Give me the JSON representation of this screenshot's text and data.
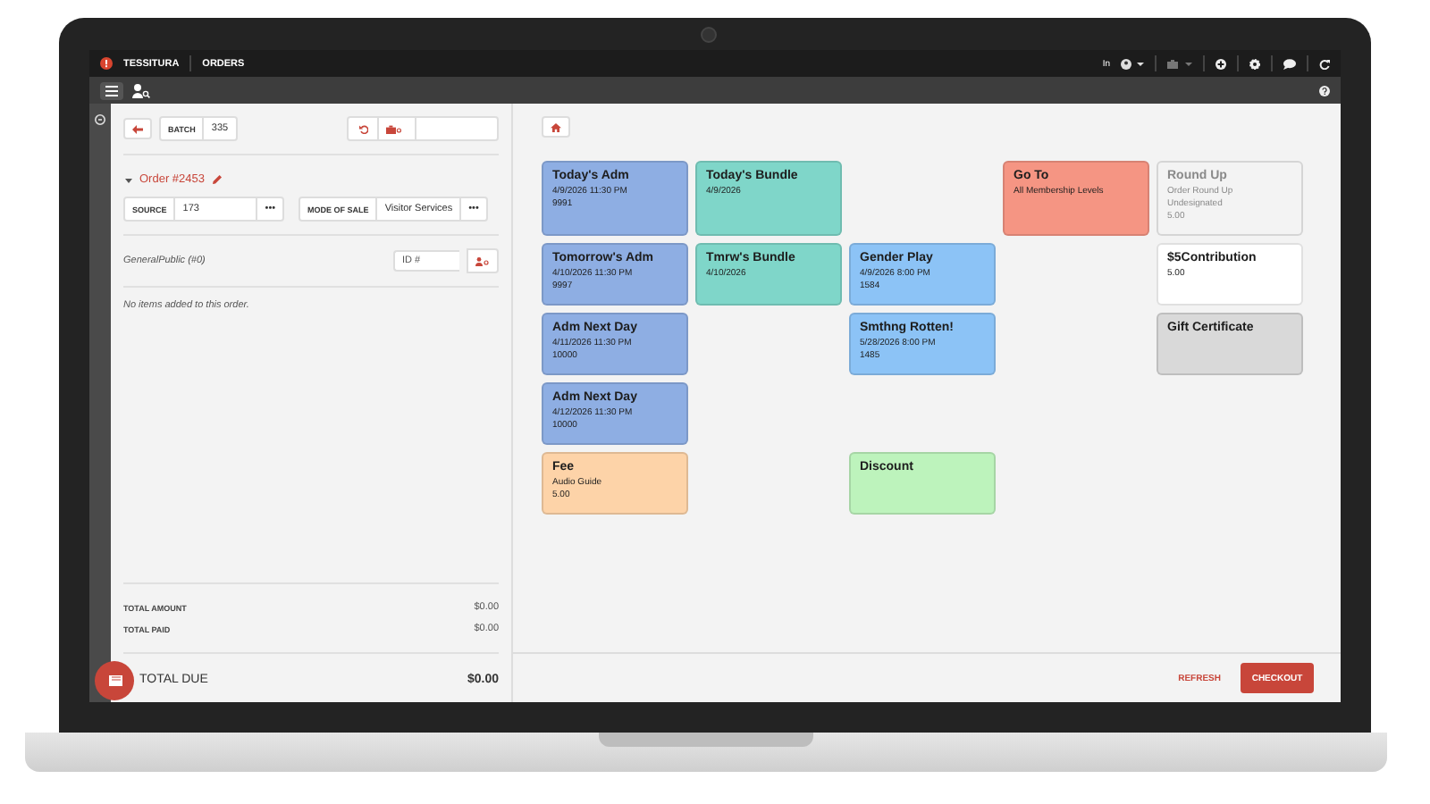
{
  "topbar": {
    "brand": "TESSITURA",
    "section": "ORDERS",
    "user_label": "In"
  },
  "batch": {
    "label": "BATCH",
    "value": "335"
  },
  "order": {
    "title": "Order #2453",
    "expanded": true
  },
  "source": {
    "label": "SOURCE",
    "value": "173",
    "more": "•••"
  },
  "mode_of_sale": {
    "label": "MODE OF SALE",
    "value": "Visitor Services",
    "more": "•••"
  },
  "constituent": {
    "name": "GeneralPublic (#0)",
    "id_field": {
      "placeholder": "ID #"
    }
  },
  "empty_message": "No items added to this order.",
  "totals": [
    {
      "label": "TOTAL AMOUNT",
      "value": "$0.00",
      "kind": "minor"
    },
    {
      "label": "TOTAL PAID",
      "value": "$0.00",
      "kind": "minor"
    },
    {
      "label": "TOTAL DUE",
      "value": "$0.00",
      "kind": "major"
    }
  ],
  "tile_rows": [
    [
      {
        "kind": "tile",
        "title": "Today's Adm",
        "lines": [
          "4/9/2026 11:30 PM",
          "9991"
        ],
        "color": "#8eaee3",
        "disabled": false
      },
      {
        "kind": "tile",
        "title": "Today's Bundle",
        "lines": [
          "4/9/2026"
        ],
        "color": "#7fd6c9",
        "disabled": false
      },
      {
        "kind": "empty"
      },
      {
        "kind": "tile",
        "title": "Go To",
        "lines": [
          "All Membership Levels"
        ],
        "color": "#f59583",
        "disabled": false
      },
      {
        "kind": "tile",
        "title": "Round Up",
        "lines": [
          "Order Round Up",
          "Undesignated",
          "5.00"
        ],
        "color": "#f3f3f3",
        "disabled": true
      }
    ],
    [
      {
        "kind": "tile",
        "title": "Tomorrow's Adm",
        "lines": [
          "4/10/2026 11:30 PM",
          "9997"
        ],
        "color": "#8eaee3",
        "disabled": false
      },
      {
        "kind": "tile",
        "title": "Tmrw's Bundle",
        "lines": [
          "4/10/2026"
        ],
        "color": "#7fd6c9",
        "disabled": false
      },
      {
        "kind": "tile",
        "title": "Gender Play",
        "lines": [
          "4/9/2026 8:00 PM",
          "1584"
        ],
        "color": "#8cc3f6",
        "disabled": false
      },
      {
        "kind": "empty"
      },
      {
        "kind": "tile",
        "title": "$5Contribution",
        "lines": [
          "5.00"
        ],
        "color": "#ffffff",
        "disabled": false
      }
    ],
    [
      {
        "kind": "tile",
        "title": "Adm Next Day",
        "lines": [
          "4/11/2026 11:30 PM",
          "10000"
        ],
        "color": "#8eaee3",
        "disabled": false
      },
      {
        "kind": "empty"
      },
      {
        "kind": "tile",
        "title": "Smthng Rotten!",
        "lines": [
          "5/28/2026 8:00 PM",
          "1485"
        ],
        "color": "#8cc3f6",
        "disabled": false
      },
      {
        "kind": "empty"
      },
      {
        "kind": "tile",
        "title": "Gift Certificate",
        "color": "#d9d9d9",
        "disabled": false
      }
    ],
    [
      {
        "kind": "tile",
        "title": "Adm Next Day",
        "lines": [
          "4/12/2026 11:30 PM",
          "10000"
        ],
        "color": "#8eaee3",
        "disabled": false
      }
    ],
    [
      {
        "kind": "tile",
        "title": "Fee",
        "lines": [
          "Audio Guide",
          "5.00"
        ],
        "color": "#fdd3a8",
        "disabled": false
      },
      {
        "kind": "empty"
      },
      {
        "kind": "tile",
        "title": "Discount",
        "color": "#bdf3bc",
        "disabled": false
      }
    ]
  ],
  "footer": {
    "refresh": "REFRESH",
    "checkout": "CHECKOUT"
  }
}
